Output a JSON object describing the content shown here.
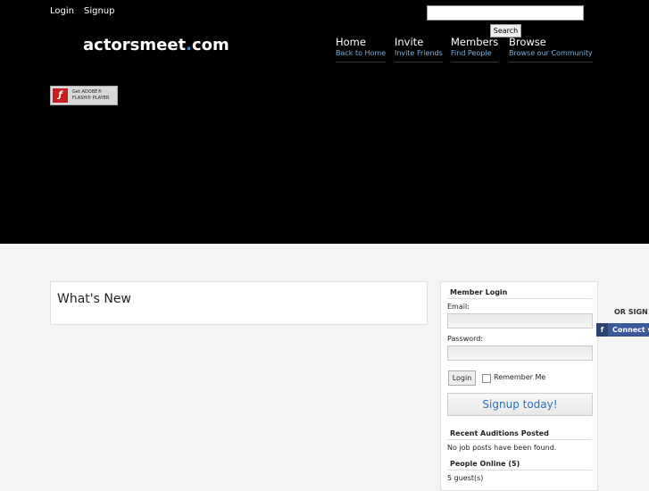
{
  "top_links": {
    "login": "Login",
    "signup": "Signup"
  },
  "search": {
    "button": "Search",
    "value": ""
  },
  "logo": {
    "name": "actorsmeet",
    "dot": ".",
    "tld": "com"
  },
  "nav": [
    {
      "title": "Home",
      "sub": "Back to Home"
    },
    {
      "title": "Invite",
      "sub": "Invite Friends"
    },
    {
      "title": "Members",
      "sub": "Find People"
    },
    {
      "title": "Browse",
      "sub": "Browse our Community"
    }
  ],
  "flash_badge": {
    "line1": "Get ADOBE®",
    "line2": "FLASH® PLAYER",
    "icon": "flash-icon"
  },
  "main": {
    "whats_new_title": "What's New"
  },
  "sidebar": {
    "member_login_title": "Member Login",
    "email_label": "Email:",
    "password_label": "Password:",
    "login_button": "Login",
    "remember_me": "Remember Me",
    "signup_today": "Signup today!",
    "recent_auditions_title": "Recent Auditions Posted",
    "no_jobs_text": "No job posts have been found.",
    "people_online_title": "People Online (5)",
    "guests_text": "5 guest(s)"
  },
  "social": {
    "or_sign": "OR SIGN I",
    "connect": "Connect w",
    "icon": "facebook-icon"
  }
}
